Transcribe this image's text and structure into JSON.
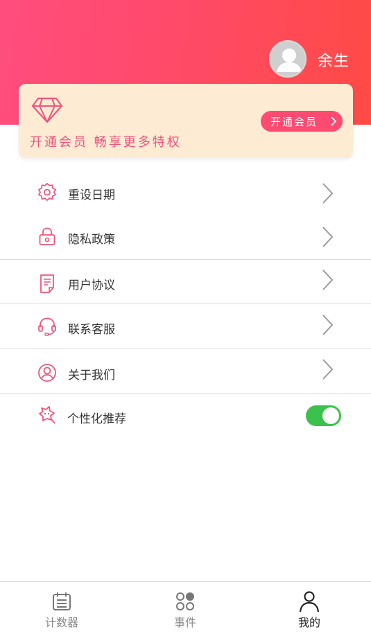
{
  "header": {
    "username": "余生",
    "avatar_icon": "user-avatar-icon"
  },
  "vip": {
    "icon": "diamond-icon",
    "slogan": "开通会员 畅享更多特权",
    "button_label": "开通会员"
  },
  "menu": {
    "items": [
      {
        "label": "重设日期",
        "icon": "gear-icon"
      },
      {
        "label": "隐私政策",
        "icon": "lock-icon"
      },
      {
        "label": "用户协议",
        "icon": "document-icon"
      },
      {
        "label": "联系客服",
        "icon": "headset-icon"
      },
      {
        "label": "关于我们",
        "icon": "user-circle-icon"
      },
      {
        "label": "个性化推荐",
        "icon": "star-tag-icon",
        "toggle_on": true
      }
    ]
  },
  "tabbar": {
    "tabs": [
      {
        "label": "计数器",
        "icon": "calendar-icon",
        "active": false
      },
      {
        "label": "事件",
        "icon": "dots-grid-icon",
        "active": false
      },
      {
        "label": "我的",
        "icon": "person-icon",
        "active": true
      }
    ]
  },
  "colors": {
    "accent": "#ff4a72",
    "header_start": "#ff4d7e",
    "header_end": "#ff4a45",
    "vip_card_bg": "#fdebd4",
    "toggle_on": "#3cc24c"
  }
}
